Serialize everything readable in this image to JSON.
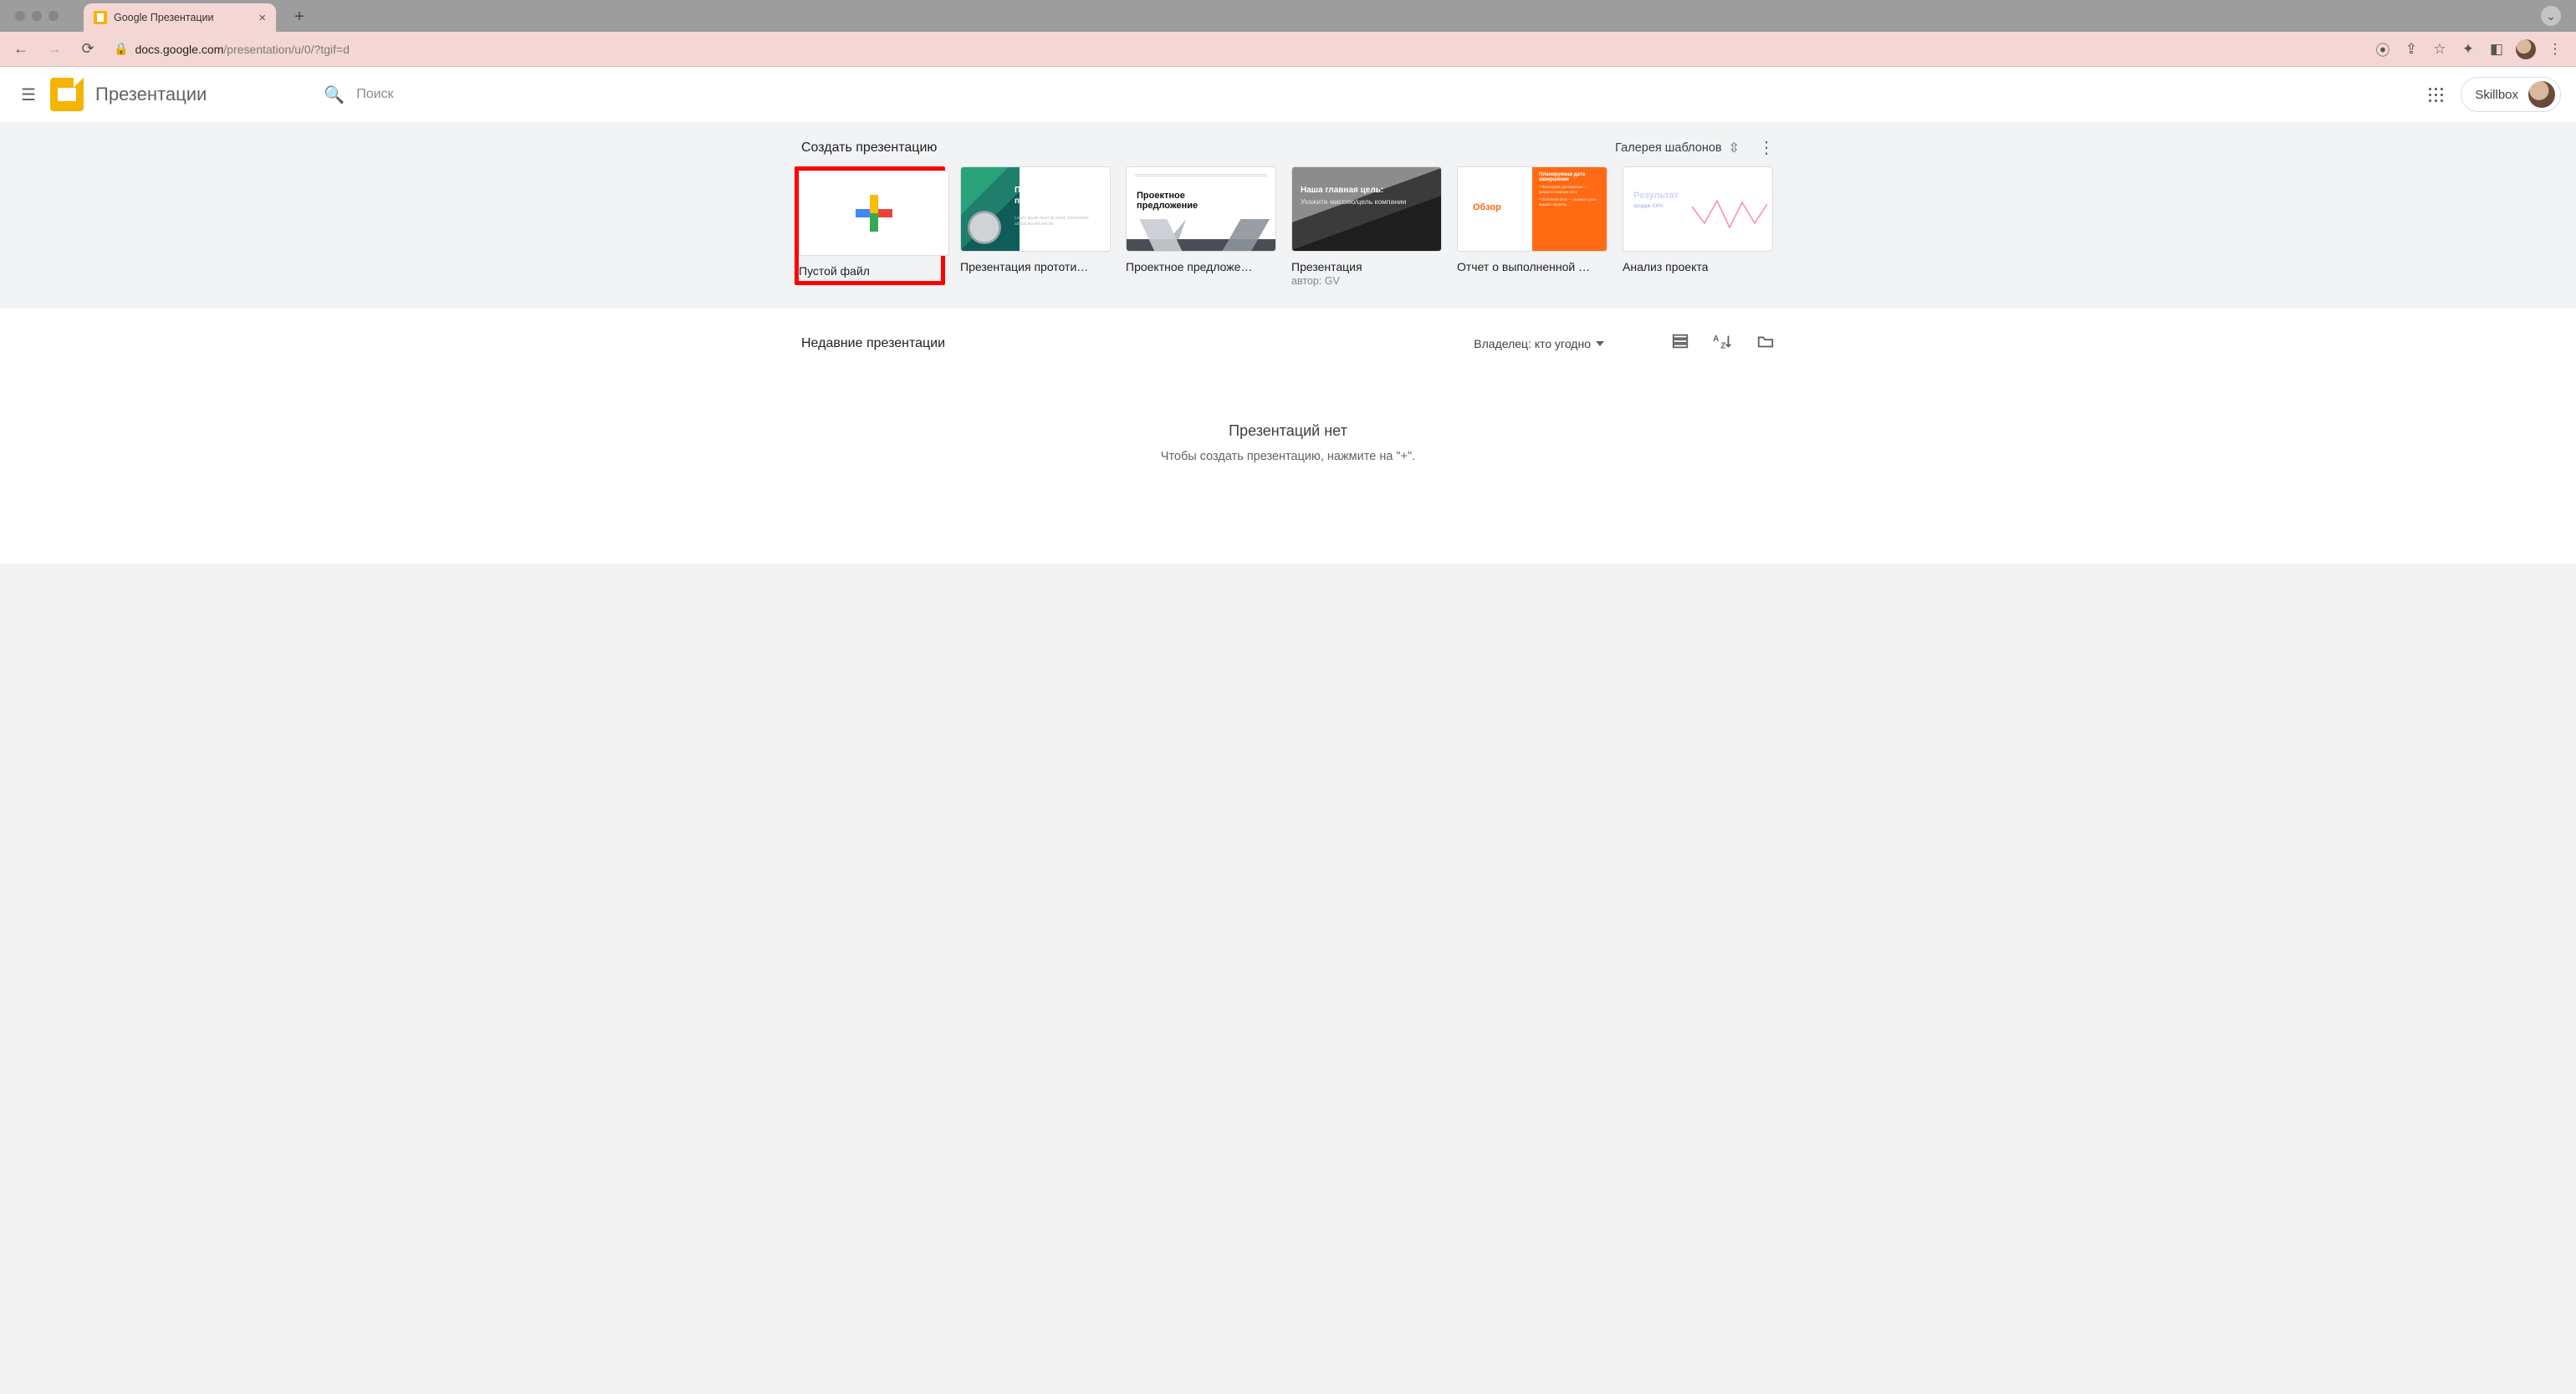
{
  "browser": {
    "tab_title": "Google Презентации",
    "url_host": "docs.google.com",
    "url_path": "/presentation/u/0/?tgif=d"
  },
  "header": {
    "app_title": "Презентации",
    "search_placeholder": "Поиск",
    "account_label": "Skillbox"
  },
  "templates": {
    "heading": "Создать презентацию",
    "gallery_label": "Галерея шаблонов",
    "items": [
      {
        "label": "Пустой файл",
        "sublabel": ""
      },
      {
        "label": "Презентация прототи…",
        "sublabel": "",
        "thumb_title": "Презентация прототипов"
      },
      {
        "label": "Проектное предложе…",
        "sublabel": "",
        "thumb_title1": "Проектное",
        "thumb_title2": "предложение"
      },
      {
        "label": "Презентация",
        "sublabel": "автор: GV",
        "thumb_title": "Наша главная цель:",
        "thumb_sub": "Укажите миссию/цель компании"
      },
      {
        "label": "Отчет о выполненной …",
        "sublabel": "",
        "thumb_word": "Обзор"
      },
      {
        "label": "Анализ проекта",
        "sublabel": "",
        "thumb_title": "Результат"
      }
    ]
  },
  "recent": {
    "heading": "Недавние презентации",
    "owner_filter": "Владелец: кто угодно",
    "empty_title": "Презентаций нет",
    "empty_hint": "Чтобы создать презентацию, нажмите на \"+\"."
  }
}
